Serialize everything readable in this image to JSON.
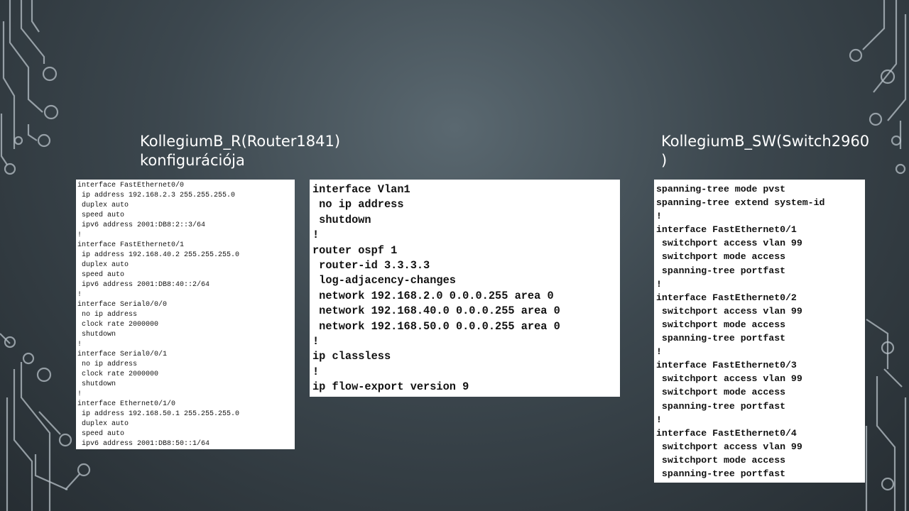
{
  "slide": {
    "router_title": [
      "KollegiumB_R(Router1841)",
      "konfigurációja"
    ],
    "switch_title": [
      "KollegiumB_SW(Switch2960",
      ")"
    ]
  },
  "router_config": [
    "interface FastEthernet0/0",
    " ip address 192.168.2.3 255.255.255.0",
    " duplex auto",
    " speed auto",
    " ipv6 address 2001:DB8:2::3/64",
    "!",
    "interface FastEthernet0/1",
    " ip address 192.168.40.2 255.255.255.0",
    " duplex auto",
    " speed auto",
    " ipv6 address 2001:DB8:40::2/64",
    "!",
    "interface Serial0/0/0",
    " no ip address",
    " clock rate 2000000",
    " shutdown",
    "!",
    "interface Serial0/0/1",
    " no ip address",
    " clock rate 2000000",
    " shutdown",
    "!",
    "interface Ethernet0/1/0",
    " ip address 192.168.50.1 255.255.255.0",
    " duplex auto",
    " speed auto",
    " ipv6 address 2001:DB8:50::1/64"
  ],
  "ospf_config": [
    "interface Vlan1",
    " no ip address",
    " shutdown",
    "!",
    "router ospf 1",
    " router-id 3.3.3.3",
    " log-adjacency-changes",
    " network 192.168.2.0 0.0.0.255 area 0",
    " network 192.168.40.0 0.0.0.255 area 0",
    " network 192.168.50.0 0.0.0.255 area 0",
    "!",
    "ip classless",
    "!",
    "ip flow-export version 9"
  ],
  "switch_config": [
    "spanning-tree mode pvst",
    "spanning-tree extend system-id",
    "!",
    "interface FastEthernet0/1",
    " switchport access vlan 99",
    " switchport mode access",
    " spanning-tree portfast",
    "!",
    "interface FastEthernet0/2",
    " switchport access vlan 99",
    " switchport mode access",
    " spanning-tree portfast",
    "!",
    "interface FastEthernet0/3",
    " switchport access vlan 99",
    " switchport mode access",
    " spanning-tree portfast",
    "!",
    "interface FastEthernet0/4",
    " switchport access vlan 99",
    " switchport mode access",
    " spanning-tree portfast"
  ],
  "theme": {
    "background": "#3c474e",
    "circuit_color": "#b8c2c8",
    "title_color": "#ffffff",
    "panel_bg": "#ffffff"
  }
}
